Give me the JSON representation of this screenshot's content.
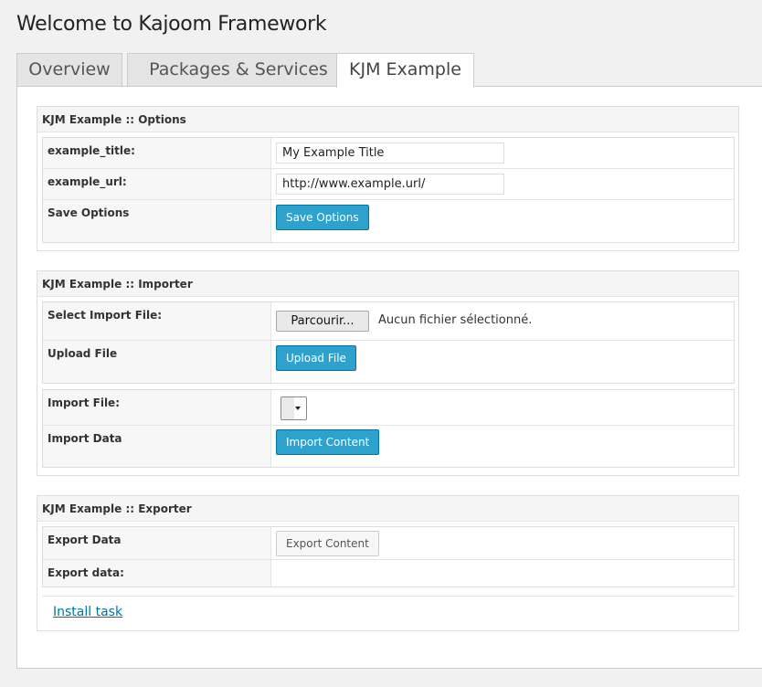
{
  "page": {
    "title": "Welcome to Kajoom Framework"
  },
  "tabs": [
    {
      "label": "Overview"
    },
    {
      "label": "Packages & Services"
    },
    {
      "label": "KJM Example"
    }
  ],
  "options": {
    "title": "KJM Example :: Options",
    "rows": {
      "example_title": {
        "label": "example_title:",
        "value": "My Example Title"
      },
      "example_url": {
        "label": "example_url:",
        "value": "http://www.example.url/"
      },
      "save": {
        "label": "Save Options",
        "button": "Save Options"
      }
    }
  },
  "importer": {
    "title": "KJM Example :: Importer",
    "select_file": {
      "label": "Select Import File:",
      "button": "Parcourir...",
      "status": "Aucun fichier sélectionné."
    },
    "upload": {
      "label": "Upload File",
      "button": "Upload File"
    },
    "import_file": {
      "label": "Import File:",
      "selected": ""
    },
    "import_data": {
      "label": "Import Data",
      "button": "Import Content"
    }
  },
  "exporter": {
    "title": "KJM Example :: Exporter",
    "export_data": {
      "label": "Export Data",
      "button": "Export Content"
    },
    "export_data_out": {
      "label": "Export data:",
      "value": ""
    },
    "install_link": "Install task"
  },
  "colors": {
    "primary_button": "#2ea2cc",
    "link": "#0074a2",
    "background": "#f1f1f1"
  }
}
